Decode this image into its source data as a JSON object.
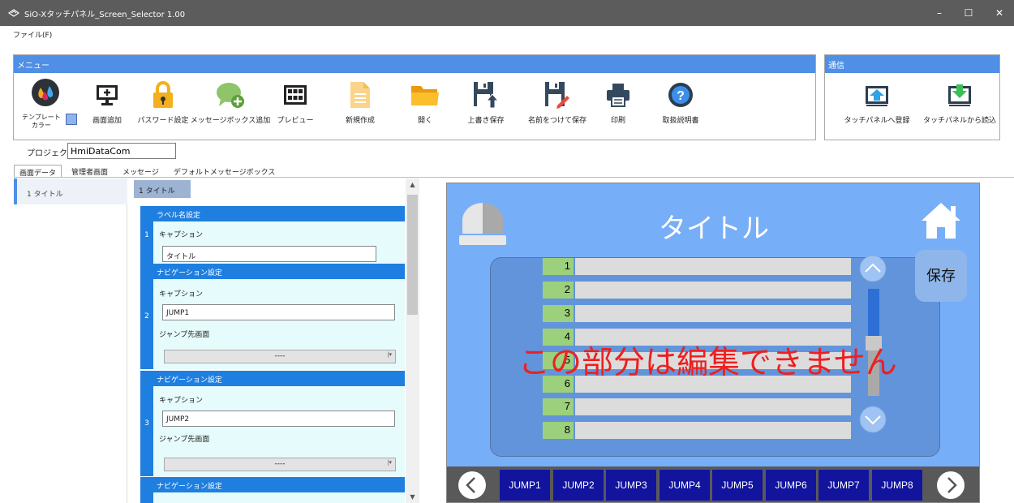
{
  "window": {
    "title": "SiO-Xタッチパネル_Screen_Selector 1.00",
    "controls": [
      "–",
      "☐",
      "✕"
    ]
  },
  "menubar": {
    "file": "ファイル(F)"
  },
  "menu_panel": {
    "header": "メニュー",
    "template_label_line1": "テンプレート",
    "template_label_line2": "カラー",
    "tools": [
      {
        "label": "画面追加",
        "icon": "monitor-add-icon"
      },
      {
        "label": "パスワード設定",
        "icon": "lock-icon"
      },
      {
        "label": "メッセージボックス追加",
        "icon": "chat-add-icon"
      },
      {
        "label": "プレビュー",
        "icon": "preview-grid-icon"
      },
      {
        "label": "新規作成",
        "icon": "new-document-icon"
      },
      {
        "label": "開く",
        "icon": "folder-icon"
      },
      {
        "label": "上書き保存",
        "icon": "save-overwrite-icon"
      },
      {
        "label": "名前をつけて保存",
        "icon": "save-as-icon"
      },
      {
        "label": "印刷",
        "icon": "printer-icon"
      },
      {
        "label": "取扱説明書",
        "icon": "help-icon"
      }
    ]
  },
  "comm_panel": {
    "header": "通信",
    "register": "タッチパネルへ登録",
    "read": "タッチパネルから読込"
  },
  "project": {
    "label": "プロジェクト名",
    "value": "HmiDataCom"
  },
  "tabs": [
    "画面データ",
    "管理者画面",
    "メッセージ",
    "デフォルトメッセージボックス"
  ],
  "screen_list": [
    "1 タイトル"
  ],
  "editor": {
    "tab": "1 タイトル",
    "groups": [
      {
        "num": "1",
        "header": "ラベル名設定",
        "caption_label": "キャプション",
        "caption_value": "タイトル"
      },
      {
        "num": "2",
        "header": "ナビゲーション設定",
        "caption_label": "キャプション",
        "caption_value": "JUMP1",
        "jump_label": "ジャンプ先画面",
        "jump_value": "----"
      },
      {
        "num": "3",
        "header": "ナビゲーション設定",
        "caption_label": "キャプション",
        "caption_value": "JUMP2",
        "jump_label": "ジャンプ先画面",
        "jump_value": "----"
      },
      {
        "header": "ナビゲーション設定"
      }
    ]
  },
  "preview": {
    "title": "タイトル",
    "save": "保存",
    "rows": [
      "1",
      "2",
      "3",
      "4",
      "5",
      "6",
      "7",
      "8"
    ],
    "notice": "この部分は編集できません",
    "jumps": [
      "JUMP1",
      "JUMP2",
      "JUMP3",
      "JUMP4",
      "JUMP5",
      "JUMP6",
      "JUMP7",
      "JUMP8"
    ],
    "colors": {
      "background": "#77aef8",
      "nav": "#595959",
      "jump_button": "#12149e",
      "row_number": "#9cd07c",
      "notice": "#ec2020"
    }
  }
}
